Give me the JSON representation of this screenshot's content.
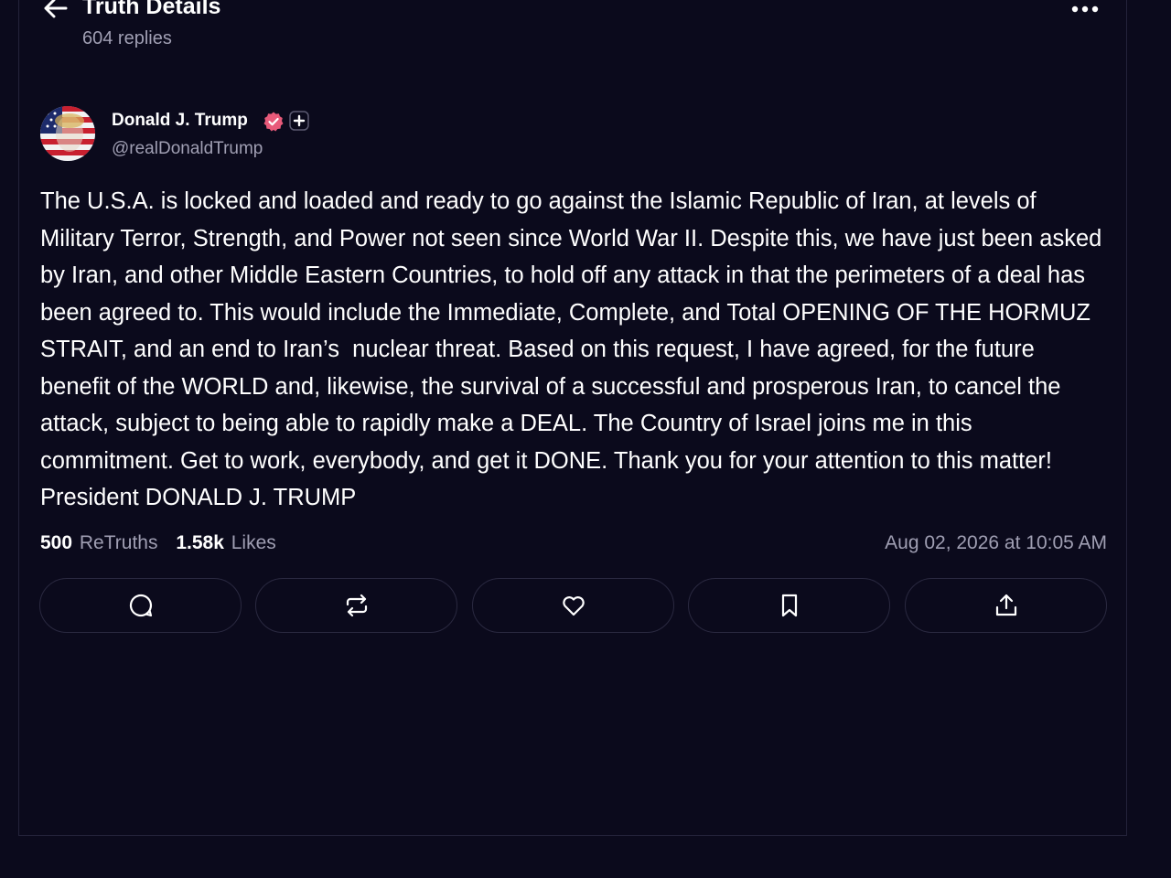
{
  "header": {
    "title": "Truth Details",
    "replies": "604 replies",
    "back_icon": "arrow-left-icon",
    "more_icon": "ellipsis-icon"
  },
  "post": {
    "author": {
      "name": "Donald J. Trump",
      "handle": "@realDonaldTrump",
      "verified_icon": "verified-badge-icon",
      "plus_icon": "plus-badge-icon",
      "verified_color": "#e85a7a"
    },
    "text": "The U.S.A. is locked and loaded and ready to go against the Islamic Republic of Iran, at levels of Military Terror, Strength, and Power not seen since World War II. Despite this, we have just been asked by Iran, and other Middle Eastern Countries, to hold off any attack in that the perimeters of a deal has been agreed to. This would include the Immediate, Complete, and Total OPENING OF THE HORMUZ STRAIT, and an end to Iran’s  nuclear threat. Based on this request, I have agreed, for the future benefit of the WORLD and, likewise, the survival of a successful and prosperous Iran, to cancel the attack, subject to being able to rapidly make a DEAL. The Country of Israel joins me in this commitment. Get to work, everybody, and get it DONE. Thank you for your attention to this matter! President DONALD J. TRUMP",
    "stats": {
      "retruths_count": "500",
      "retruths_label": "ReTruths",
      "likes_count": "1.58k",
      "likes_label": "Likes"
    },
    "timestamp": "Aug 02, 2026 at 10:05 AM"
  },
  "actions": [
    {
      "icon": "reply-icon"
    },
    {
      "icon": "retruth-icon"
    },
    {
      "icon": "like-icon"
    },
    {
      "icon": "bookmark-icon"
    },
    {
      "icon": "share-icon"
    }
  ],
  "colors": {
    "background": "#0b0a1c",
    "muted_text": "#a09fb3",
    "border": "#2a2940"
  }
}
